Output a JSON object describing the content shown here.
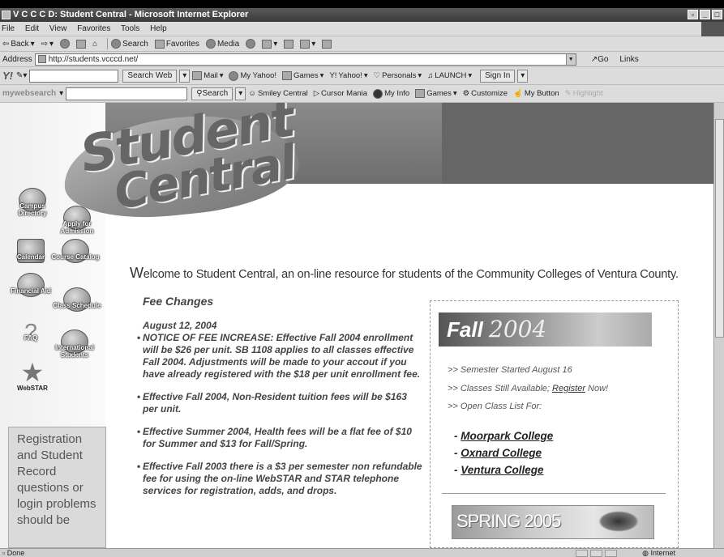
{
  "window": {
    "title": "V C C C D: Student Central - Microsoft Internet Explorer",
    "controls": [
      "▫",
      "_",
      "□"
    ]
  },
  "menu": [
    "File",
    "Edit",
    "View",
    "Favorites",
    "Tools",
    "Help"
  ],
  "toolbar": {
    "back": "Back",
    "search": "Search",
    "favorites": "Favorites",
    "media": "Media"
  },
  "address": {
    "label": "Address",
    "url": "http://students.vcccd.net/",
    "go": "Go",
    "links": "Links"
  },
  "yahoo": {
    "search_btn": "Search Web",
    "items": [
      "Mail",
      "My Yahoo!",
      "Games",
      "Yahoo!",
      "Personals",
      "LAUNCH",
      "Sign In"
    ]
  },
  "mws": {
    "brand": "mywebsearch",
    "search_btn": "Search",
    "items": [
      "Smiley Central",
      "Cursor Mania",
      "My Info",
      "Games",
      "Customize",
      "My Button",
      "Highlight"
    ]
  },
  "nav": {
    "campus": "Campus Directory",
    "apply": "Apply for Admission",
    "calendar": "Calendar",
    "course": "Course Catalog",
    "financial": "Financial Aid",
    "class": "Class Schedule",
    "faq": "FAQ",
    "intl": "International Students",
    "webstar": "WebSTAR"
  },
  "regbox": "Registration and Student Record questions or login problems should be",
  "logo": {
    "line1": "Student",
    "line2": "Central"
  },
  "welcome": {
    "first": "W",
    "rest": "elcome to Student Central, an on-line resource for students of the Community Colleges of Ventura County."
  },
  "fees": {
    "heading": "Fee Changes",
    "date": "August 12, 2004",
    "items": [
      "NOTICE OF FEE INCREASE: Effective Fall 2004 enrollment will be $26 per unit. SB 1108 applies to all classes effective Fall 2004. Adjustments will be made to your accout if you have already registered with the $18 per unit enrollment fee.",
      "Effective Fall 2004, Non-Resident tuition fees will be $163 per unit.",
      "Effective Summer 2004, Health fees will be a flat fee of $10 for Summer and $13 for Fall/Spring.",
      "Effective Fall 2003 there is a $3 per semester non refundable fee for using the on-line WebSTAR and STAR telephone services for registration, adds, and drops."
    ]
  },
  "panel": {
    "fall_word": "Fall",
    "fall_year": "2004",
    "line1": ">> Semester Started August 16",
    "line2_a": ">> Classes Still Available; ",
    "line2_link": "Register",
    "line2_b": " Now!",
    "line3": ">> Open Class List For:",
    "colleges": [
      "Moorpark College",
      "Oxnard College",
      "Ventura College"
    ],
    "spring": "SPRING 2005"
  },
  "status": {
    "text": "Done",
    "zone": "Internet"
  }
}
